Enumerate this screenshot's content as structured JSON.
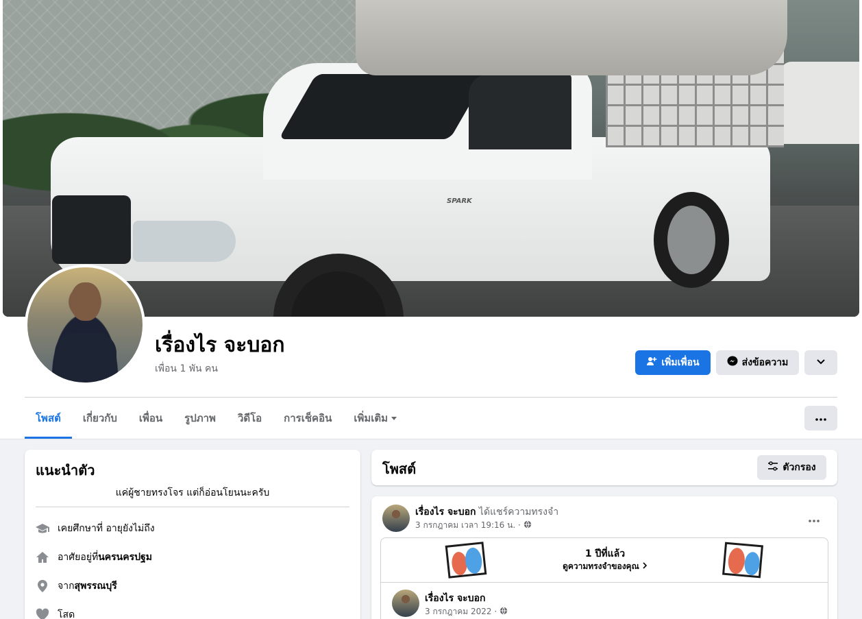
{
  "profile": {
    "name": "เรื่องไร จะบอก",
    "friends": "เพื่อน 1 พัน คน"
  },
  "actions": {
    "add_friend": "เพิ่มเพื่อน",
    "message": "ส่งข้อความ"
  },
  "cover": {
    "badge_text": "SPARK"
  },
  "tabs": [
    {
      "label": "โพสต์",
      "active": true
    },
    {
      "label": "เกี่ยวกับ"
    },
    {
      "label": "เพื่อน"
    },
    {
      "label": "รูปภาพ"
    },
    {
      "label": "วิดีโอ"
    },
    {
      "label": "การเช็คอิน"
    },
    {
      "label": "เพิ่มเติม"
    }
  ],
  "intro": {
    "title": "แนะนำตัว",
    "bio": "แค่ผู้ชายทรงโจร แต่ก็อ่อนโยนนะครับ",
    "items": [
      {
        "icon": "graduation-cap-icon",
        "text": "เคยศึกษาที่ อายุยังไม่ถึง",
        "bold": ""
      },
      {
        "icon": "home-icon",
        "text": "อาศัยอยู่ที่ ",
        "bold": "นครนครปฐม"
      },
      {
        "icon": "location-pin-icon",
        "text": "จาก ",
        "bold": "สุพรรณบุรี"
      },
      {
        "icon": "heart-icon",
        "text": "โสด",
        "bold": ""
      }
    ]
  },
  "posts": {
    "title": "โพสต์",
    "filter": "ตัวกรอง",
    "post": {
      "author": "เรื่องไร จะบอก",
      "action": " ได้แชร์ความทรงจำ",
      "meta": "3 กรกฎาคม เวลา 19:16 น. ·",
      "memory_years": "1 ปีที่แล้ว",
      "memory_link": "ดูความทรงจำของคุณ",
      "shared_author": "เรื่องไร จะบอก",
      "shared_meta": "3 กรกฎาคม 2022 ·"
    }
  },
  "colors": {
    "accent": "#1b74e4",
    "secondary_button": "#e4e6eb",
    "page_bg": "#f0f2f5"
  }
}
